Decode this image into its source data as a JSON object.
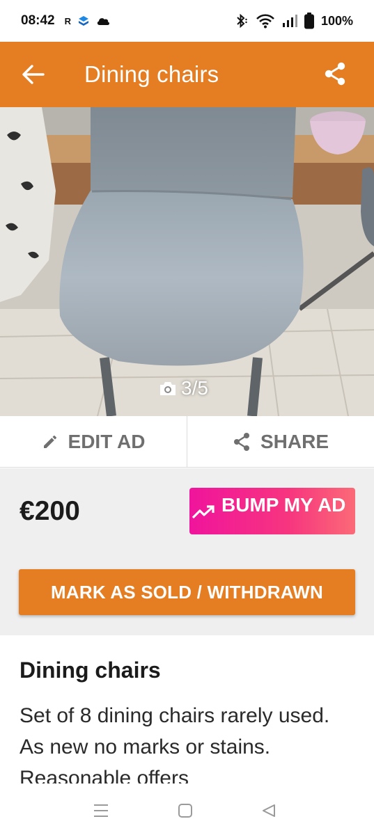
{
  "status_bar": {
    "time": "08:42",
    "indicator_r": "R",
    "battery": "100%"
  },
  "app_bar": {
    "title": "Dining chairs",
    "color": "#e57e22"
  },
  "photo": {
    "counter": "3/5"
  },
  "actions": {
    "edit_label": "EDIT AD",
    "share_label": "SHARE"
  },
  "listing": {
    "price": "€200",
    "bump_label": "BUMP MY AD",
    "sold_label": "MARK AS SOLD / WITHDRAWN",
    "title": "Dining chairs",
    "description": "Set of 8 dining chairs rarely used. As new no marks or stains. Reasonable offers"
  },
  "colors": {
    "accent": "#e57e22",
    "bump_start": "#f0149c",
    "bump_end": "#fb6a77"
  },
  "icons": [
    "back-arrow-icon",
    "share-icon",
    "camera-icon",
    "pencil-icon",
    "trending-up-icon",
    "recents-icon",
    "home-icon",
    "back-triangle-icon"
  ]
}
